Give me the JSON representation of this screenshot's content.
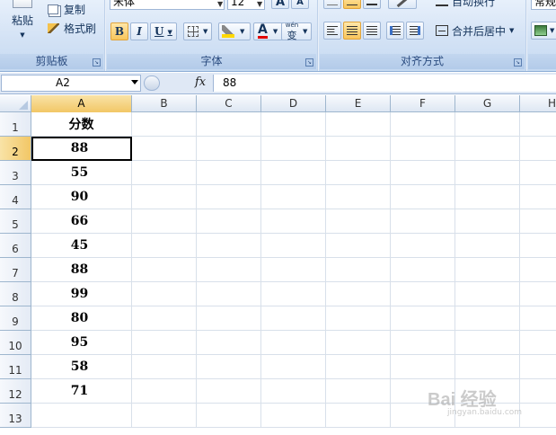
{
  "ribbon": {
    "clipboard": {
      "paste_label": "粘贴",
      "copy_label": "复制",
      "format_painter_label": "格式刷",
      "group_label": "剪贴板"
    },
    "font": {
      "font_name": "宋体",
      "font_size": "12",
      "bold": "B",
      "italic": "I",
      "underline": "U",
      "grow": "A",
      "shrink": "A",
      "font_color_glyph": "A",
      "phonetic_glyph": "变",
      "phonetic_top": "wén",
      "group_label": "字体"
    },
    "alignment": {
      "wrap_text_label": "自动换行",
      "merge_center_label": "合并后居中",
      "group_label": "对齐方式"
    },
    "number": {
      "format_label": "常规"
    }
  },
  "formula_bar": {
    "name_box": "A2",
    "fx": "fx",
    "formula": "88"
  },
  "sheet": {
    "columns": [
      "A",
      "B",
      "C",
      "D",
      "E",
      "F",
      "G",
      "H"
    ],
    "rows": [
      "1",
      "2",
      "3",
      "4",
      "5",
      "6",
      "7",
      "8",
      "9",
      "10",
      "11",
      "12",
      "13"
    ],
    "column_a": [
      "分数",
      "88",
      "55",
      "90",
      "66",
      "45",
      "88",
      "99",
      "80",
      "95",
      "58",
      "71",
      ""
    ]
  },
  "watermark": {
    "main": "Bai  经验",
    "sub": "jingyan.baidu.com"
  },
  "colors": {
    "ribbon_bg": "#d3e2f5",
    "active_button": "#f8c55c",
    "header_selected": "#f2c766",
    "grid_line": "#d8e0ea"
  }
}
